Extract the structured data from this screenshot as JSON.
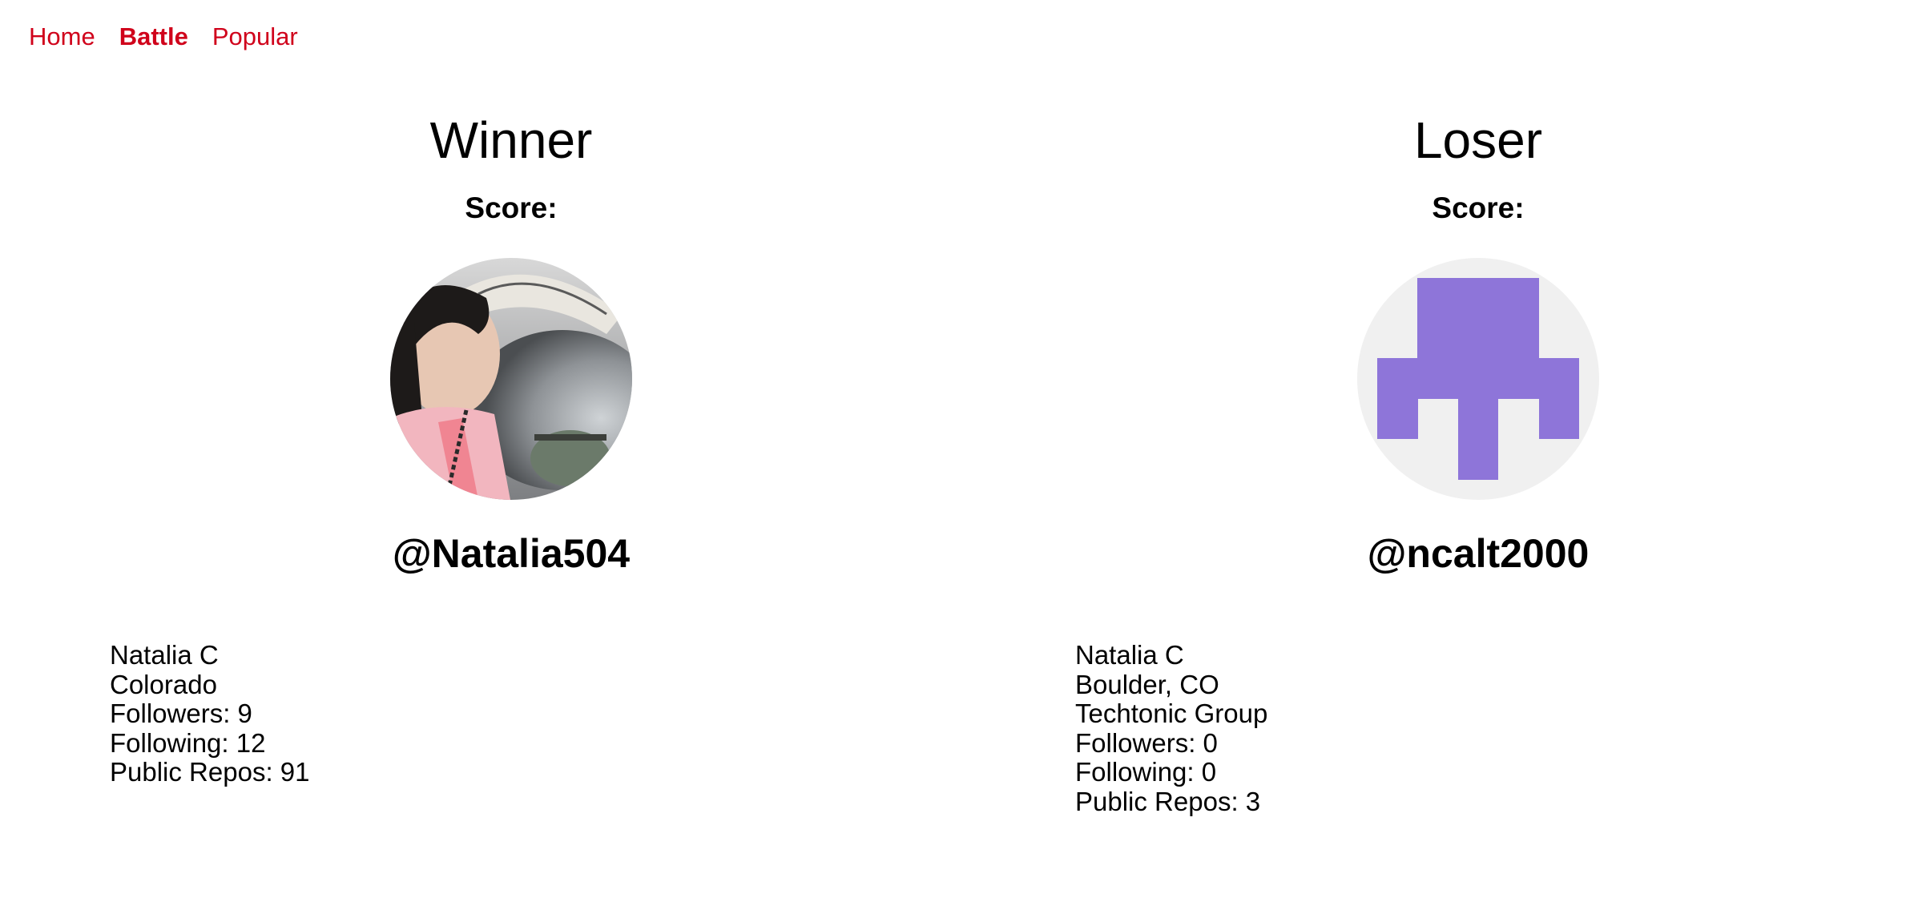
{
  "nav": {
    "items": [
      {
        "label": "Home",
        "active": false
      },
      {
        "label": "Battle",
        "active": true
      },
      {
        "label": "Popular",
        "active": false
      }
    ],
    "accent_color": "#d0021b"
  },
  "winner": {
    "header": "Winner",
    "score_label": "Score:",
    "username": "@Natalia504",
    "avatar": "photo-avatar",
    "details": {
      "name": "Natalia C",
      "location": "Colorado",
      "followers": "Followers: 9",
      "following": "Following: 12",
      "public_repos": "Public Repos: 91"
    }
  },
  "loser": {
    "header": "Loser",
    "score_label": "Score:",
    "username": "@ncalt2000",
    "avatar": "identicon-avatar",
    "avatar_color": "#8e75d9",
    "avatar_bg": "#f0f0f0",
    "details": {
      "name": "Natalia C",
      "location": "Boulder, CO",
      "company": "Techtonic Group",
      "followers": "Followers: 0",
      "following": "Following: 0",
      "public_repos": "Public Repos: 3"
    }
  }
}
